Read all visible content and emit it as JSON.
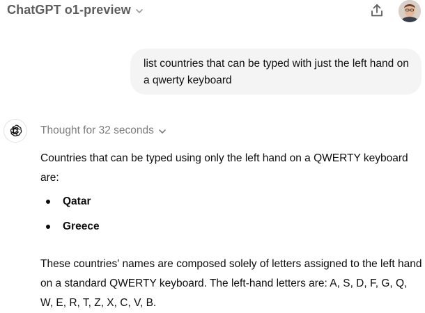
{
  "header": {
    "model_name": "ChatGPT o1-preview",
    "icons": {
      "model_dropdown": "chevron-down-icon",
      "share": "share-icon",
      "avatar": "user-avatar"
    }
  },
  "conversation": {
    "user_message": "list countries that can be typed with just the left hand on a qwerty keyboard",
    "assistant": {
      "icon": "openai-logo-icon",
      "thought_label": "Thought for 32 seconds",
      "intro": "Countries that can be typed using only the left hand on a QWERTY keyboard are:",
      "countries": [
        "Qatar",
        "Greece"
      ],
      "explanation": "These countries' names are composed solely of letters assigned to the left hand on a standard QWERTY keyboard. The left-hand letters are: A, S, D, F, G, Q, W, E, R, T, Z, X, C, V, B."
    }
  },
  "colors": {
    "user_bubble_bg": "#f4f4f4",
    "muted_text": "#7d7d7d",
    "text": "#0d0d0d"
  }
}
